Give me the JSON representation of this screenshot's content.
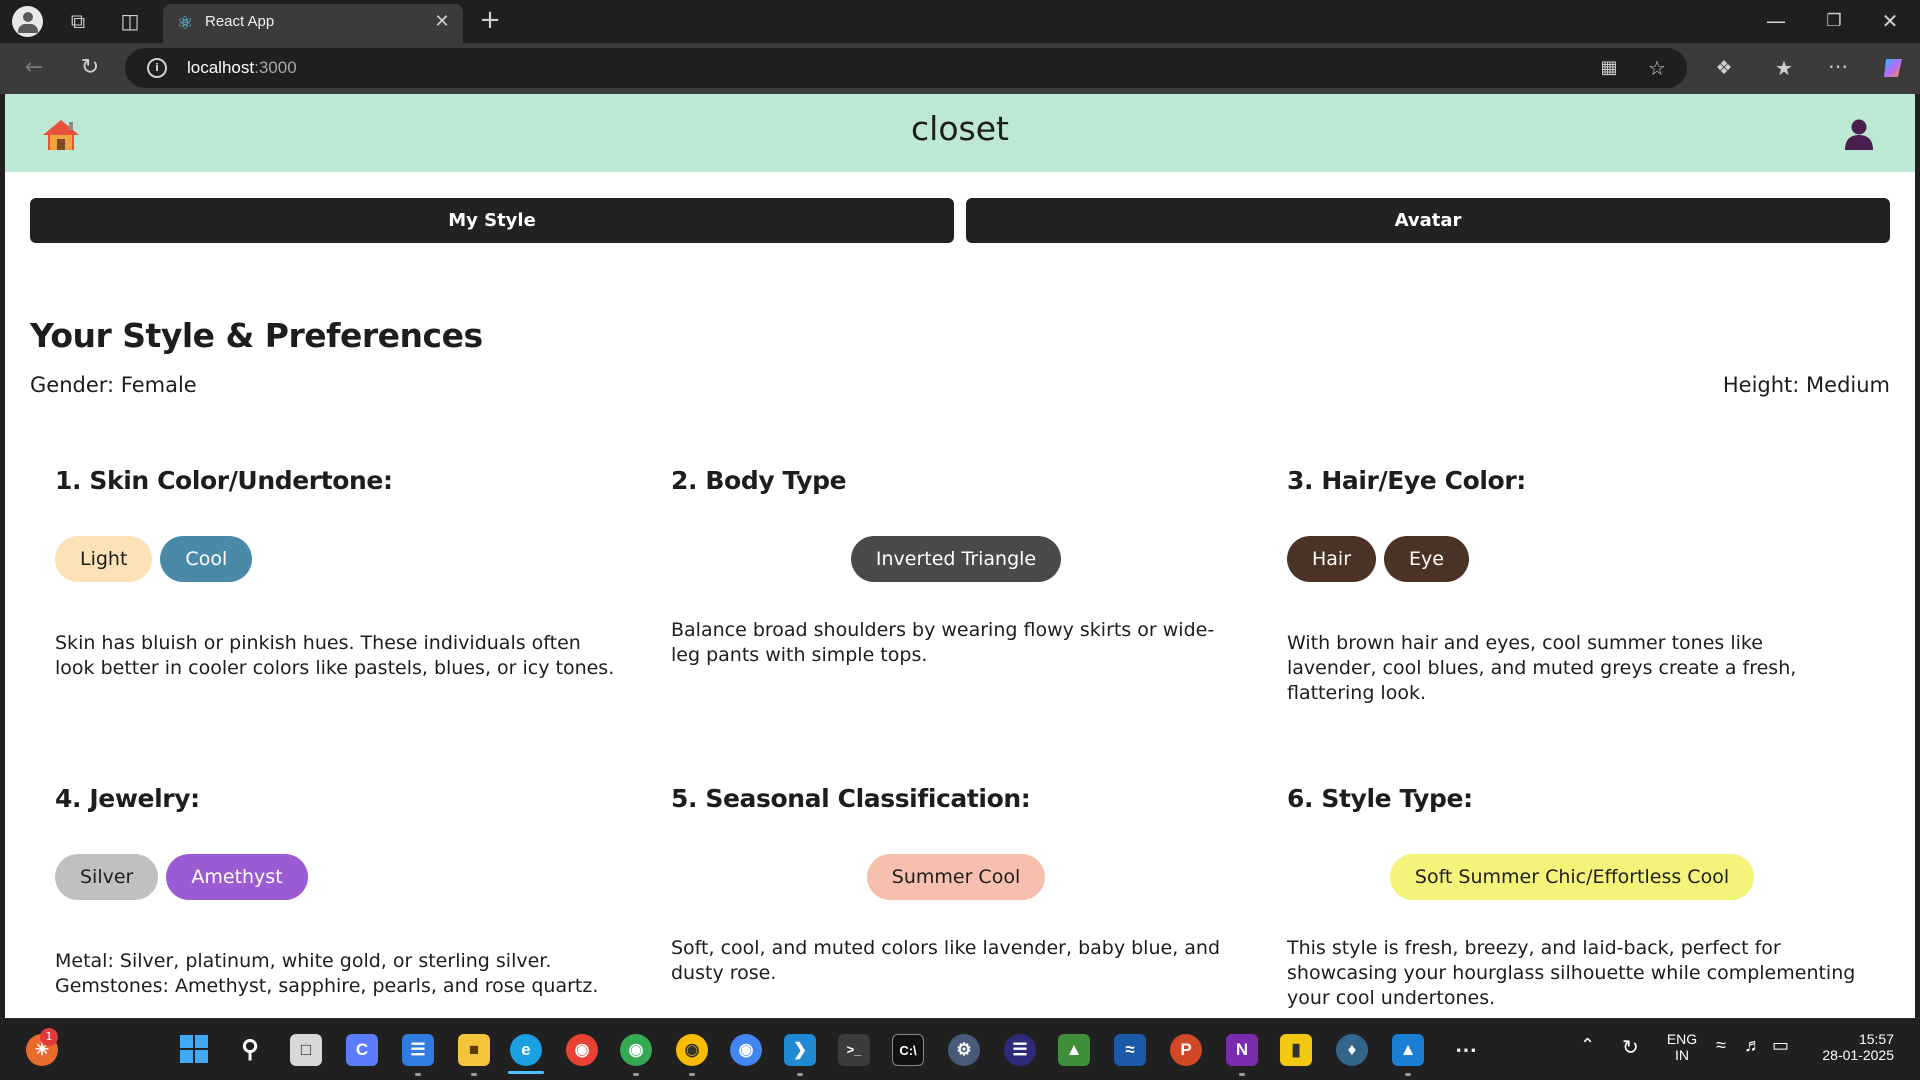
{
  "browser": {
    "tab_title": "React App",
    "url_host": "localhost",
    "url_port": ":3000"
  },
  "app": {
    "title": "closet",
    "nav": {
      "my_style": "My Style",
      "avatar": "Avatar"
    },
    "heading": "Your Style & Preferences",
    "gender": "Gender: Female",
    "height": "Height: Medium",
    "sections": [
      {
        "title": "1. Skin Color/Undertone:",
        "chips": [
          {
            "label": "Light",
            "bg": "#fde2b8",
            "color": "#1d1d1d"
          },
          {
            "label": "Cool",
            "bg": "#4a8aa8",
            "color": "#ffffff"
          }
        ],
        "description": "Skin has bluish or pinkish hues. These individuals often look better in cooler colors like pastels, blues, or icy tones."
      },
      {
        "title": "2. Body Type",
        "chips": [
          {
            "label": "Inverted Triangle",
            "bg": "#4a4a4a",
            "color": "#ffffff"
          }
        ],
        "description": "Balance broad shoulders by wearing flowy skirts or wide-leg pants with simple tops."
      },
      {
        "title": "3. Hair/Eye Color:",
        "chips": [
          {
            "label": "Hair",
            "bg": "#4a3326",
            "color": "#ffffff"
          },
          {
            "label": "Eye",
            "bg": "#4a3326",
            "color": "#ffffff"
          }
        ],
        "description": "With brown hair and eyes, cool summer tones like lavender, cool blues, and muted greys create a fresh, flattering look."
      },
      {
        "title": "4. Jewelry:",
        "chips": [
          {
            "label": "Silver",
            "bg": "#c0c0c0",
            "color": "#1d1d1d"
          },
          {
            "label": "Amethyst",
            "bg": "#9a5bd3",
            "color": "#ffffff"
          }
        ],
        "description": "Metal: Silver, platinum, white gold, or sterling silver. Gemstones: Amethyst, sapphire, pearls, and rose quartz."
      },
      {
        "title": "5. Seasonal Classification:",
        "chips": [
          {
            "label": "Summer Cool",
            "bg": "#f7c0ae",
            "color": "#1d1d1d"
          }
        ],
        "description": "Soft, cool, and muted colors like lavender, baby blue, and dusty rose."
      },
      {
        "title": "6. Style Type:",
        "chips": [
          {
            "label": "Soft Summer Chic/Effortless Cool",
            "bg": "#f4f47a",
            "color": "#1d1d1d"
          }
        ],
        "description": "This style is fresh, breezy, and laid-back, perfect for showcasing your hourglass silhouette while complementing your cool undertones."
      }
    ]
  },
  "taskbar": {
    "lang": "ENG",
    "region": "IN",
    "time": "15:57",
    "date": "28-01-2025",
    "badge": "1"
  },
  "colors": {
    "header_bg": "#bde8d3",
    "button_bg": "#222222",
    "user_icon": "#4a1f4f"
  }
}
